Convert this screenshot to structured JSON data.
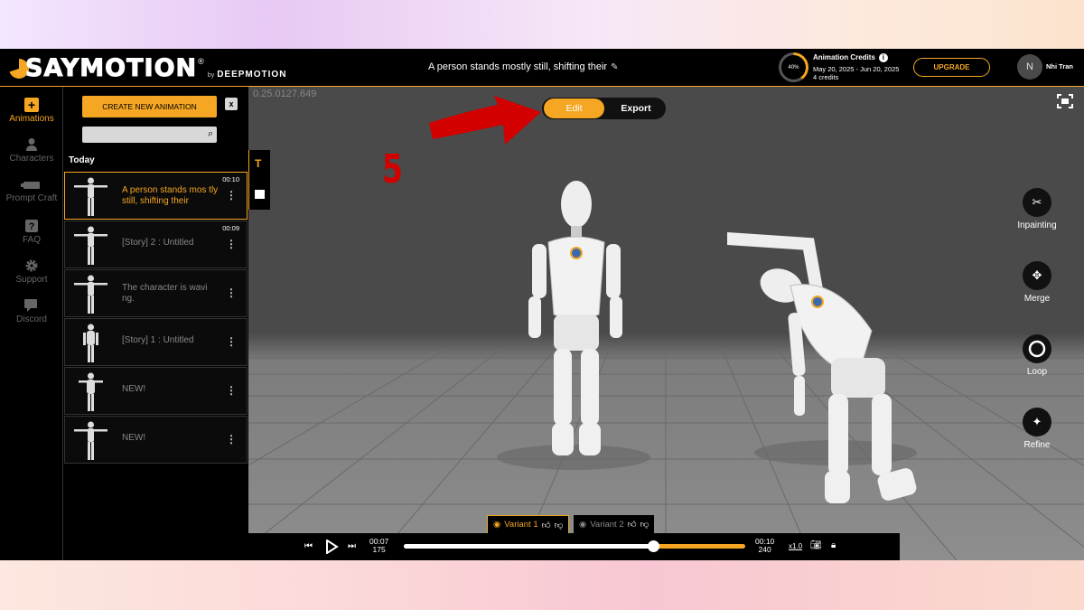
{
  "header": {
    "logo_text": "SAYMOTION",
    "logo_reg": "®",
    "logo_by": "by",
    "logo_company": "DEEPMOTION",
    "title": "A person stands mostly still, shifting their",
    "credits": {
      "percent_label": "40%",
      "percent_value": 0.4,
      "title": "Animation Credits",
      "dates": "May 20, 2025 - Jun 20, 2025",
      "count": "4 credits"
    },
    "upgrade_label": "UPGRADE",
    "avatar_initial": "N",
    "user_name": "Nhi Tran"
  },
  "nav": {
    "items": [
      {
        "label": "Animations",
        "icon": "plus-icon",
        "active": true
      },
      {
        "label": "Characters",
        "icon": "person-icon"
      },
      {
        "label": "Prompt Craft",
        "icon": "prompt-icon"
      },
      {
        "label": "FAQ",
        "icon": "question-icon"
      },
      {
        "label": "Support",
        "icon": "gear-icon"
      },
      {
        "label": "Discord",
        "icon": "chat-icon"
      }
    ]
  },
  "panel": {
    "create_label": "CREATE NEW ANIMATION",
    "close_label": "x",
    "search_placeholder": "",
    "section_label": "Today",
    "items": [
      {
        "title": "A person stands mos tly still, shifting their",
        "duration": "00:10",
        "active": true
      },
      {
        "title": "[Story] 2 : Untitled",
        "duration": "00:09"
      },
      {
        "title": "The character is wavi ng.",
        "duration": ""
      },
      {
        "title": "[Story] 1 : Untitled",
        "duration": ""
      },
      {
        "title": "NEW!",
        "duration": ""
      },
      {
        "title": "NEW!",
        "duration": ""
      }
    ]
  },
  "viewport": {
    "version": "0.25.0127.649",
    "edit_label": "Edit",
    "export_label": "Export",
    "step_number": "5",
    "tools": [
      {
        "label": "Inpainting",
        "icon": "inpainting-icon"
      },
      {
        "label": "Merge",
        "icon": "merge-icon"
      },
      {
        "label": "Loop",
        "icon": "loop-icon"
      },
      {
        "label": "Refine",
        "icon": "wand-icon"
      }
    ]
  },
  "variants": [
    {
      "label": "Variant 1",
      "active": true
    },
    {
      "label": "Variant 2",
      "active": false
    }
  ],
  "player": {
    "current_time": "00:07",
    "current_frame": "175",
    "total_time": "00:10",
    "total_frames": "240",
    "speed": "x1.0",
    "progress": 0.73
  },
  "colors": {
    "accent": "#f5a623",
    "annotation_red": "#d30000"
  }
}
